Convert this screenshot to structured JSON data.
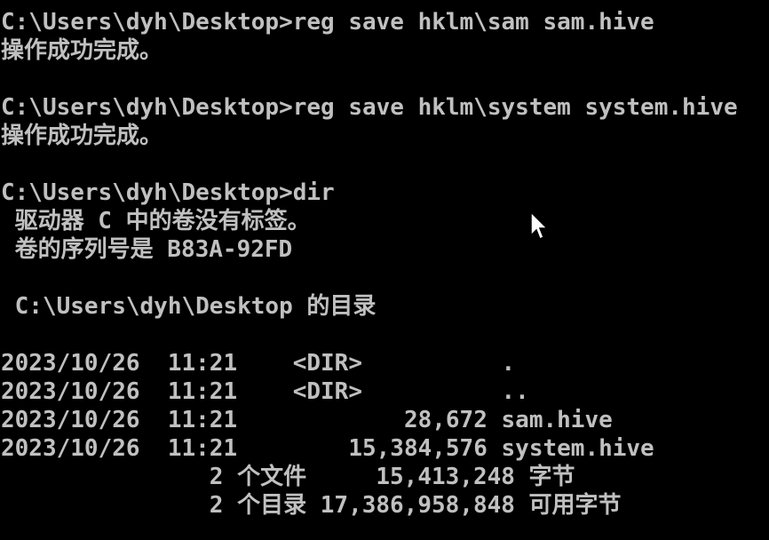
{
  "console": {
    "lines": [
      "C:\\Users\\dyh\\Desktop>reg save hklm\\sam sam.hive",
      "操作成功完成。",
      "",
      "C:\\Users\\dyh\\Desktop>reg save hklm\\system system.hive",
      "操作成功完成。",
      "",
      "C:\\Users\\dyh\\Desktop>dir",
      " 驱动器 C 中的卷没有标签。",
      " 卷的序列号是 B83A-92FD",
      "",
      " C:\\Users\\dyh\\Desktop 的目录",
      "",
      "2023/10/26  11:21    <DIR>          .",
      "2023/10/26  11:21    <DIR>          ..",
      "2023/10/26  11:21            28,672 sam.hive",
      "2023/10/26  11:21        15,384,576 system.hive",
      "               2 个文件     15,413,248 字节",
      "               2 个目录 17,386,958,848 可用字节"
    ]
  },
  "colors": {
    "background": "#000000",
    "text": "#c0c0c0",
    "cursor_fill": "#ffffff",
    "cursor_stroke": "#000000"
  },
  "icons": {
    "mouse_cursor": "arrow-pointer"
  }
}
